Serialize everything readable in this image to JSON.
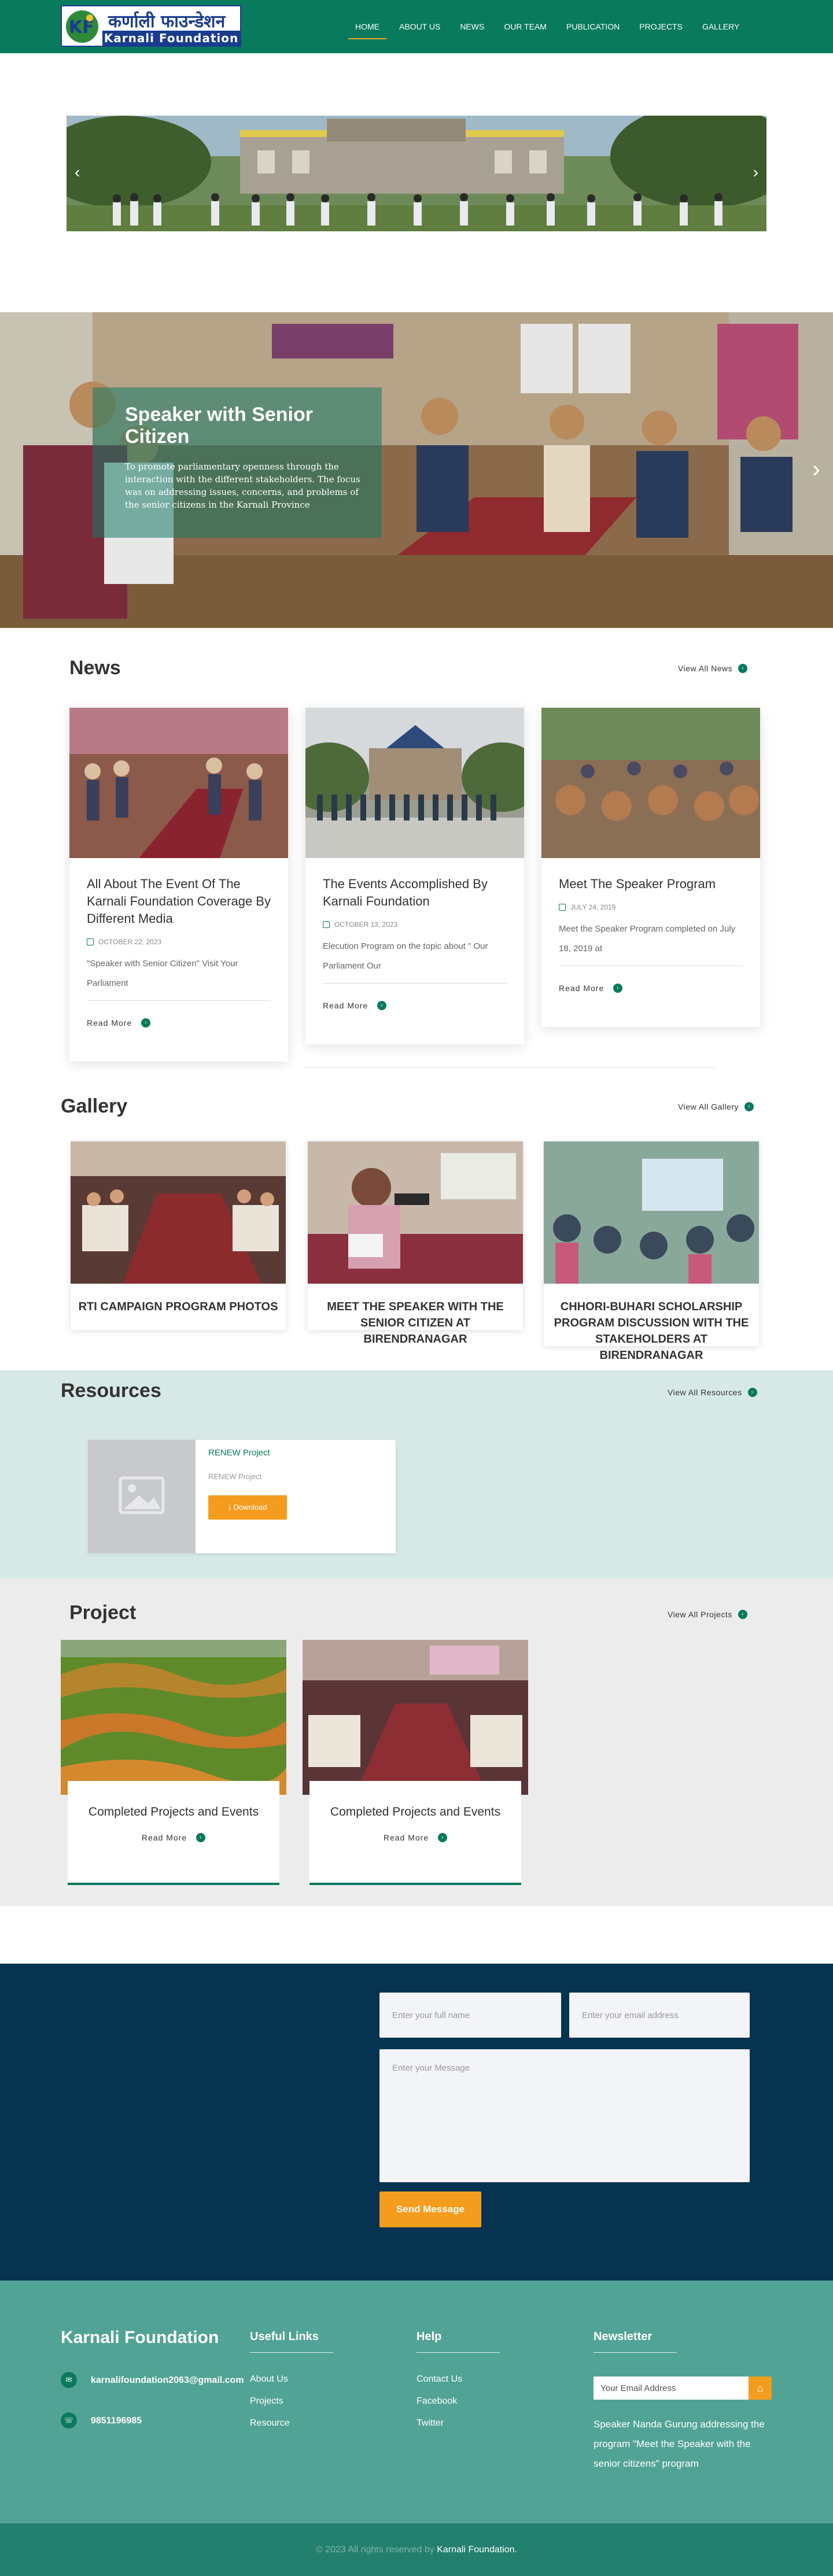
{
  "header": {
    "logo_np": "कर्णाली फाउन्डेशन",
    "logo_en": "Karnali Foundation",
    "nav": [
      "HOME",
      "ABOUT US",
      "NEWS",
      "OUR TEAM",
      "PUBLICATION",
      "PROJECTS",
      "GALLERY"
    ]
  },
  "slider": {
    "prev": "‹",
    "next": "›"
  },
  "hero": {
    "title": "Speaker with Senior Citizen",
    "text": "To promote parliamentary openness through the interaction with the different stakeholders. The focus was on addressing issues, concerns, and problems of the senior citizens in the Karnali Province",
    "next": "›"
  },
  "news": {
    "title": "News",
    "view_all": "View All News",
    "items": [
      {
        "title": "All About The Event Of The Karnali Foundation Coverage By Different Media",
        "date": "OCTOBER 22, 2023",
        "excerpt": "\"Speaker with Senior Citizen\" Visit Your Parliament",
        "read_more": "Read More"
      },
      {
        "title": "The Events Accomplished By Karnali Foundation",
        "date": "OCTOBER 13, 2023",
        "excerpt": "Elecution Program on the topic about \" Our Parliament Our",
        "read_more": "Read More"
      },
      {
        "title": "Meet The Speaker Program",
        "date": "JULY 24, 2019",
        "excerpt": "Meet the Speaker Program completed on July 18, 2019 at",
        "read_more": "Read More"
      }
    ]
  },
  "gallery": {
    "title": "Gallery",
    "view_all": "View All Gallery",
    "items": [
      {
        "caption": "RTI CAMPAIGN PROGRAM PHOTOS"
      },
      {
        "caption": "MEET THE SPEAKER WITH THE SENIOR CITIZEN AT BIRENDRANAGAR"
      },
      {
        "caption": "CHHORI-BUHARI SCHOLARSHIP PROGRAM DISCUSSION WITH THE STAKEHOLDERS AT BIRENDRANAGAR"
      }
    ]
  },
  "resources": {
    "title": "Resources",
    "view_all": "View All Resources",
    "item": {
      "title": "RENEW Project",
      "subtitle": "RENEW Project",
      "download": "Download"
    }
  },
  "project": {
    "title": "Project",
    "view_all": "View All Projects",
    "items": [
      {
        "title": "Completed Projects and Events",
        "read_more": "Read More"
      },
      {
        "title": "Completed Projects and Events",
        "read_more": "Read More"
      }
    ]
  },
  "contact": {
    "name_placeholder": "Enter your full name",
    "email_placeholder": "Enter your email address",
    "message_placeholder": "Enter your Message",
    "send": "Send Message"
  },
  "footer": {
    "brand": "Karnali Foundation",
    "email": "karnalifoundation2063@gmail.com",
    "phone": "9851196985",
    "useful_links_title": "Useful Links",
    "useful_links": [
      "About Us",
      "Projects",
      "Resource"
    ],
    "help_title": "Help",
    "help_links": [
      "Contact Us",
      "Facebook",
      "Twitter"
    ],
    "newsletter_title": "Newsletter",
    "newsletter_placeholder": "Your Email Address",
    "newsletter_text": "Speaker Nanda Gurung addressing the program \"Meet the Speaker with the senior citizens\" program",
    "copyright_prefix": "© 2023 All rights reserved by",
    "copyright_brand": "Karnali Foundation."
  },
  "colors": {
    "primary": "#0a7a5c",
    "accent": "#f39c1d",
    "navy": "#06334f",
    "footer": "#51a395",
    "resource_bg": "#d6e9e6"
  }
}
